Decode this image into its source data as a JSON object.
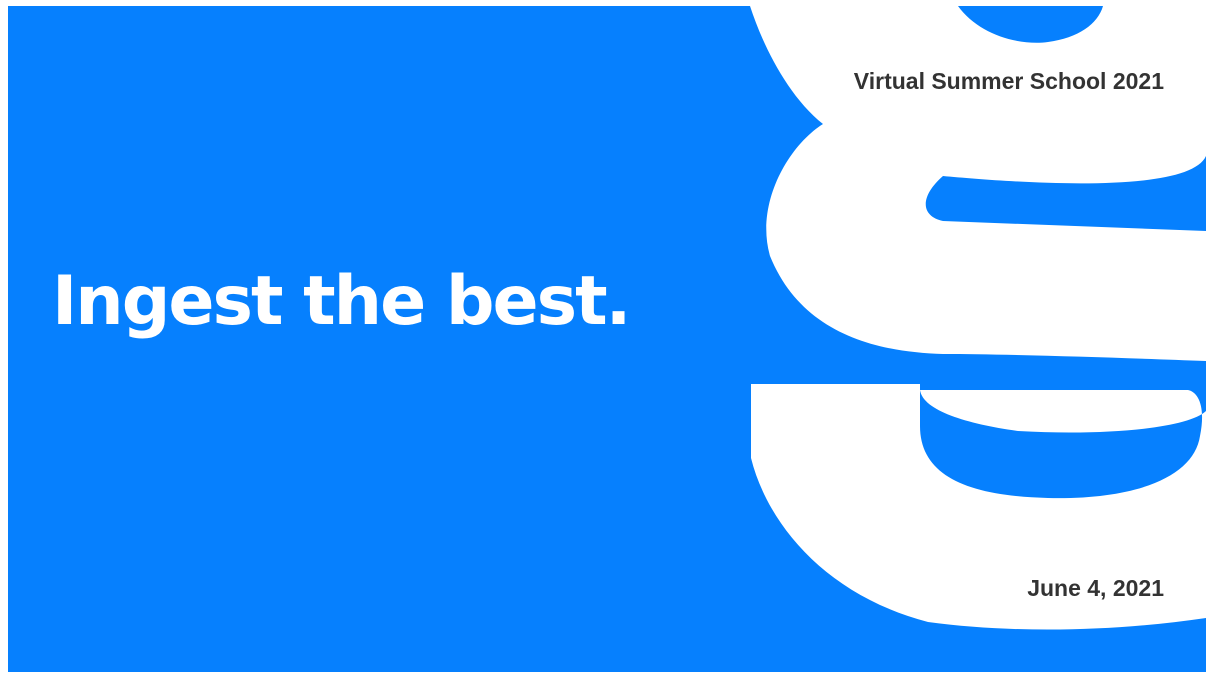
{
  "slide": {
    "headline": "Ingest the best.",
    "event_name": "Virtual Summer School 2021",
    "event_date": "June 4, 2021",
    "background_color": "#0680fe",
    "logo_color": "#ffffff",
    "text_color": "#333333",
    "logo_icon": "g-letter-logo-icon"
  }
}
